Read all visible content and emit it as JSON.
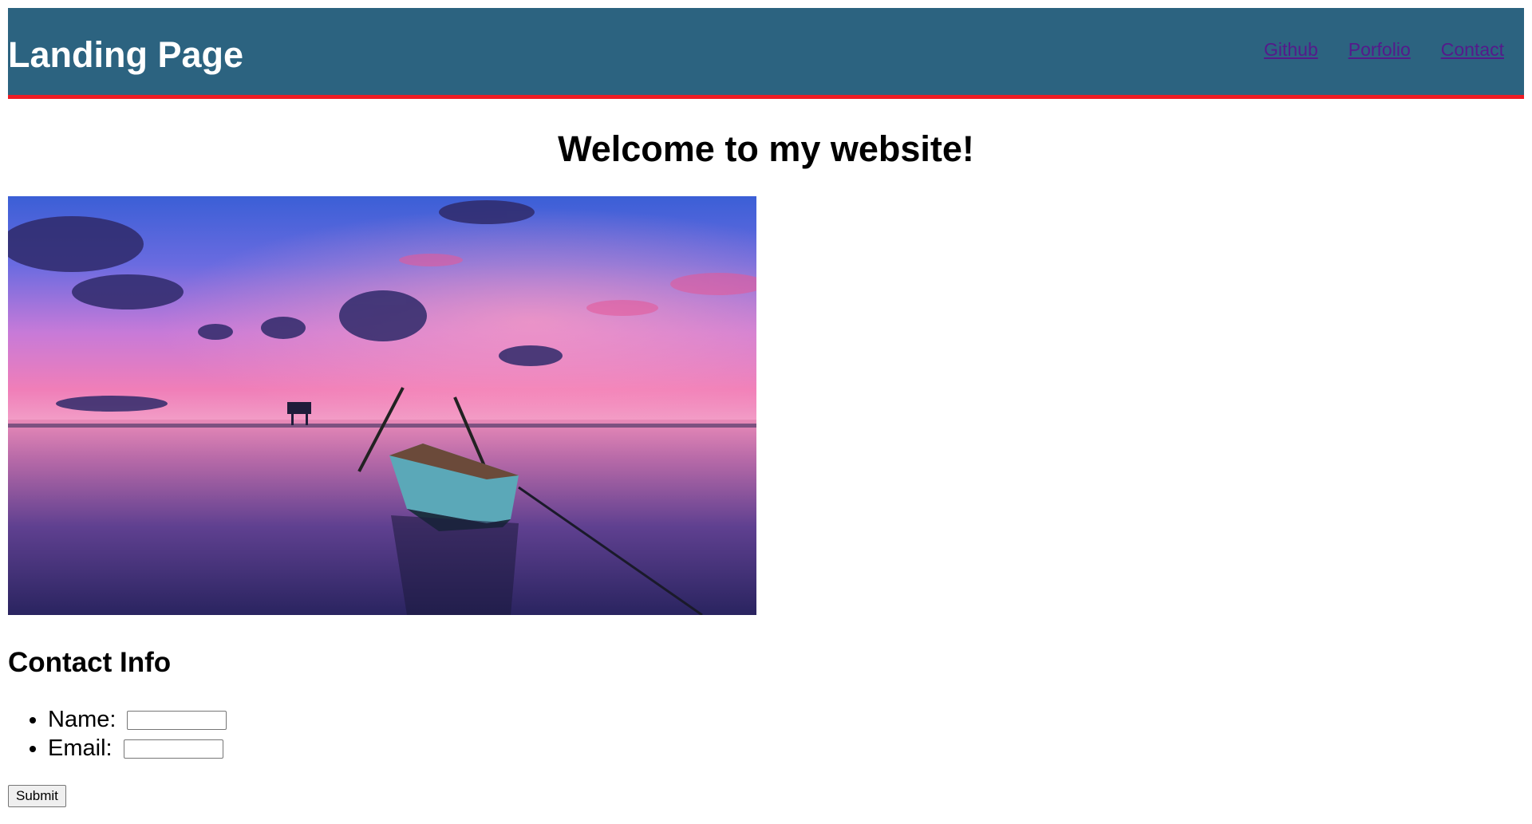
{
  "header": {
    "title": "Landing Page",
    "nav": [
      "Github",
      "Porfolio",
      "Contact"
    ],
    "bg_color": "#2c6380",
    "border_color": "#ee1c24",
    "link_color": "#551a8b"
  },
  "main": {
    "welcome": "Welcome to my website!",
    "contact_title": "Contact Info",
    "fields": [
      {
        "label": "Name:",
        "value": ""
      },
      {
        "label": "Email:",
        "value": ""
      }
    ],
    "submit_label": "Submit"
  }
}
